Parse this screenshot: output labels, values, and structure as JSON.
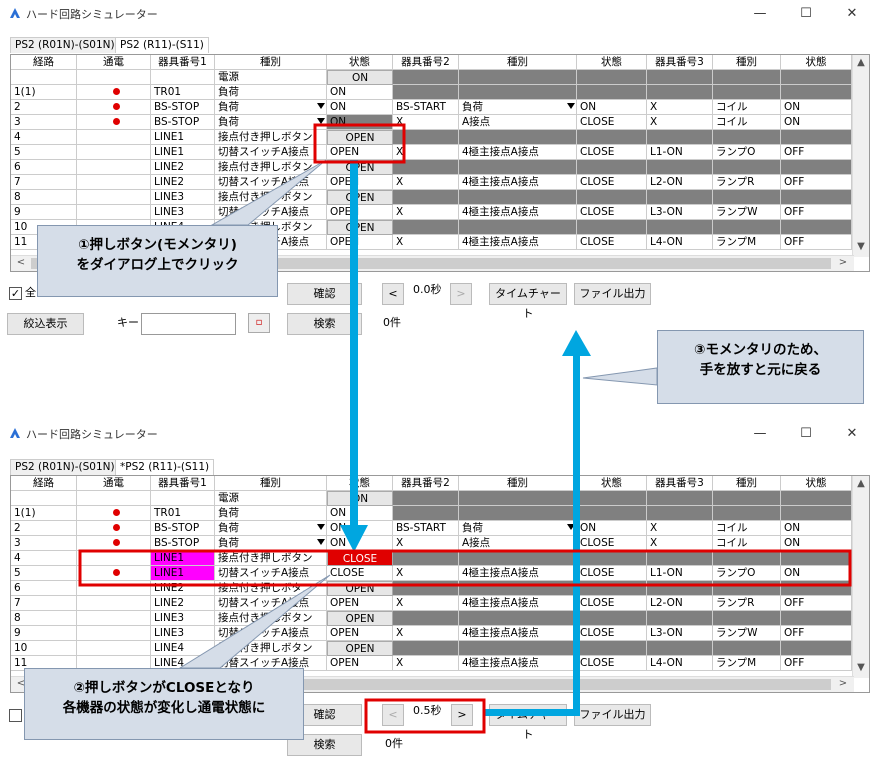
{
  "app": {
    "title": "ハード回路シミュレーター"
  },
  "window_controls": {
    "minimize": "—",
    "maximize": "☐",
    "close": "✕"
  },
  "colors": {
    "accent_arrow": "#00a6e0",
    "highlight_red": "#e00000",
    "highlight_magenta": "#ff00ff",
    "callout_bg": "#d5dde8"
  },
  "top": {
    "tabs": [
      "PS2 (R01N)-(S01N)",
      "PS2 (R11)-(S11)"
    ],
    "columns": [
      "経路",
      "通電",
      "器具番号1",
      "種別",
      "状態",
      "器具番号2",
      "種別",
      "状態",
      "器具番号3",
      "種別",
      "状態"
    ],
    "rows": [
      {
        "route": "",
        "power": false,
        "dev1": "",
        "type1": "電源",
        "state1": "ON",
        "dev2": "",
        "type2": "",
        "state2": "",
        "dev3": "",
        "type3": "",
        "state3": ""
      },
      {
        "route": "1(1)",
        "power": true,
        "dev1": "TR01",
        "type1": "負荷",
        "state1": "ON",
        "dev2": "",
        "type2": "",
        "state2": "",
        "dev3": "",
        "type3": "",
        "state3": ""
      },
      {
        "route": "2",
        "power": true,
        "dev1": "BS-STOP",
        "type1": "負荷",
        "state1": "ON",
        "dev2": "BS-START",
        "type2": "負荷",
        "state2": "ON",
        "dev3": "X",
        "type3": "コイル",
        "state3": "ON"
      },
      {
        "route": "3",
        "power": true,
        "dev1": "BS-STOP",
        "type1": "負荷",
        "state1": "ON",
        "dev2": "X",
        "type2": "A接点",
        "state2": "CLOSE",
        "dev3": "X",
        "type3": "コイル",
        "state3": "ON"
      },
      {
        "route": "4",
        "power": false,
        "dev1": "LINE1",
        "type1": "接点付き押しボタン",
        "state1": "OPEN",
        "dev2": "",
        "type2": "",
        "state2": "",
        "dev3": "",
        "type3": "",
        "state3": ""
      },
      {
        "route": "5",
        "power": false,
        "dev1": "LINE1",
        "type1": "切替スイッチA接点",
        "state1": "OPEN",
        "dev2": "X",
        "type2": "4極主接点A接点",
        "state2": "CLOSE",
        "dev3": "L1-ON",
        "type3": "ランプO",
        "state3": "OFF"
      },
      {
        "route": "6",
        "power": false,
        "dev1": "LINE2",
        "type1": "接点付き押しボタン",
        "state1": "OPEN",
        "dev2": "",
        "type2": "",
        "state2": "",
        "dev3": "",
        "type3": "",
        "state3": ""
      },
      {
        "route": "7",
        "power": false,
        "dev1": "LINE2",
        "type1": "切替スイッチA接点",
        "state1": "OPEN",
        "dev2": "X",
        "type2": "4極主接点A接点",
        "state2": "CLOSE",
        "dev3": "L2-ON",
        "type3": "ランプR",
        "state3": "OFF"
      },
      {
        "route": "8",
        "power": false,
        "dev1": "LINE3",
        "type1": "接点付き押しボタン",
        "state1": "OPEN",
        "dev2": "",
        "type2": "",
        "state2": "",
        "dev3": "",
        "type3": "",
        "state3": ""
      },
      {
        "route": "9",
        "power": false,
        "dev1": "LINE3",
        "type1": "切替スイッチA接点",
        "state1": "OPEN",
        "dev2": "X",
        "type2": "4極主接点A接点",
        "state2": "CLOSE",
        "dev3": "L3-ON",
        "type3": "ランプW",
        "state3": "OFF"
      },
      {
        "route": "10",
        "power": false,
        "dev1": "LINE4",
        "type1": "接点付き押しボタン",
        "state1": "OPEN",
        "dev2": "",
        "type2": "",
        "state2": "",
        "dev3": "",
        "type3": "",
        "state3": ""
      },
      {
        "route": "11",
        "power": false,
        "dev1": "LINE4",
        "type1": "切替スイッチA接点",
        "state1": "OPEN",
        "dev2": "X",
        "type2": "4極主接点A接点",
        "state2": "CLOSE",
        "dev3": "L4-ON",
        "type3": "ランプM",
        "state3": "OFF"
      }
    ],
    "controls": {
      "all_check": "全",
      "confirm": "確認",
      "prev": "<",
      "time": "0.0秒",
      "next": ">",
      "timechart": "タイムチャート",
      "file_out": "ファイル出力",
      "filter": "絞込表示",
      "key_label": "キー",
      "search": "検索",
      "count": "0件"
    }
  },
  "bottom": {
    "tabs": [
      "PS2 (R01N)-(S01N)",
      "*PS2 (R11)-(S11)"
    ],
    "columns": [
      "経路",
      "通電",
      "器具番号1",
      "種別",
      "状態",
      "器具番号2",
      "種別",
      "状態",
      "器具番号3",
      "種別",
      "状態"
    ],
    "rows": [
      {
        "route": "",
        "power": false,
        "dev1": "",
        "type1": "電源",
        "state1": "ON",
        "dev2": "",
        "type2": "",
        "state2": "",
        "dev3": "",
        "type3": "",
        "state3": ""
      },
      {
        "route": "1(1)",
        "power": true,
        "dev1": "TR01",
        "type1": "負荷",
        "state1": "ON",
        "dev2": "",
        "type2": "",
        "state2": "",
        "dev3": "",
        "type3": "",
        "state3": ""
      },
      {
        "route": "2",
        "power": true,
        "dev1": "BS-STOP",
        "type1": "負荷",
        "state1": "ON",
        "dev2": "BS-START",
        "type2": "負荷",
        "state2": "ON",
        "dev3": "X",
        "type3": "コイル",
        "state3": "ON"
      },
      {
        "route": "3",
        "power": true,
        "dev1": "BS-STOP",
        "type1": "負荷",
        "state1": "ON",
        "dev2": "X",
        "type2": "A接点",
        "state2": "CLOSE",
        "dev3": "X",
        "type3": "コイル",
        "state3": "ON"
      },
      {
        "route": "4",
        "power": false,
        "dev1": "LINE1",
        "type1": "接点付き押しボタン",
        "state1": "CLOSE",
        "dev2": "",
        "type2": "",
        "state2": "",
        "dev3": "",
        "type3": "",
        "state3": ""
      },
      {
        "route": "5",
        "power": true,
        "dev1": "LINE1",
        "type1": "切替スイッチA接点",
        "state1": "CLOSE",
        "dev2": "X",
        "type2": "4極主接点A接点",
        "state2": "CLOSE",
        "dev3": "L1-ON",
        "type3": "ランプO",
        "state3": "ON"
      },
      {
        "route": "6",
        "power": false,
        "dev1": "LINE2",
        "type1": "接点付き押しボタン",
        "state1": "OPEN",
        "dev2": "",
        "type2": "",
        "state2": "",
        "dev3": "",
        "type3": "",
        "state3": ""
      },
      {
        "route": "7",
        "power": false,
        "dev1": "LINE2",
        "type1": "切替スイッチA接点",
        "state1": "OPEN",
        "dev2": "X",
        "type2": "4極主接点A接点",
        "state2": "CLOSE",
        "dev3": "L2-ON",
        "type3": "ランプR",
        "state3": "OFF"
      },
      {
        "route": "8",
        "power": false,
        "dev1": "LINE3",
        "type1": "接点付き押しボタン",
        "state1": "OPEN",
        "dev2": "",
        "type2": "",
        "state2": "",
        "dev3": "",
        "type3": "",
        "state3": ""
      },
      {
        "route": "9",
        "power": false,
        "dev1": "LINE3",
        "type1": "切替スイッチA接点",
        "state1": "OPEN",
        "dev2": "X",
        "type2": "4極主接点A接点",
        "state2": "CLOSE",
        "dev3": "L3-ON",
        "type3": "ランプW",
        "state3": "OFF"
      },
      {
        "route": "10",
        "power": false,
        "dev1": "LINE4",
        "type1": "接点付き押しボタン",
        "state1": "OPEN",
        "dev2": "",
        "type2": "",
        "state2": "",
        "dev3": "",
        "type3": "",
        "state3": ""
      },
      {
        "route": "11",
        "power": false,
        "dev1": "LINE4",
        "type1": "切替スイッチA接点",
        "state1": "OPEN",
        "dev2": "X",
        "type2": "4極主接点A接点",
        "state2": "CLOSE",
        "dev3": "L4-ON",
        "type3": "ランプM",
        "state3": "OFF"
      }
    ],
    "controls": {
      "confirm": "確認",
      "prev": "<",
      "time": "0.5秒",
      "next": ">",
      "timechart": "タイムチャート",
      "file_out": "ファイル出力",
      "search": "検索",
      "count": "0件"
    }
  },
  "callouts": {
    "c1_line1": "①押しボタン(モメンタリ)",
    "c1_line2": "をダイアログ上でクリック",
    "c2_line1": "②押しボタンがCLOSEとなり",
    "c2_line2": "各機器の状態が変化し通電状態に",
    "c3_line1": "③モメンタリのため、",
    "c3_line2": "手を放すと元に戻る"
  }
}
